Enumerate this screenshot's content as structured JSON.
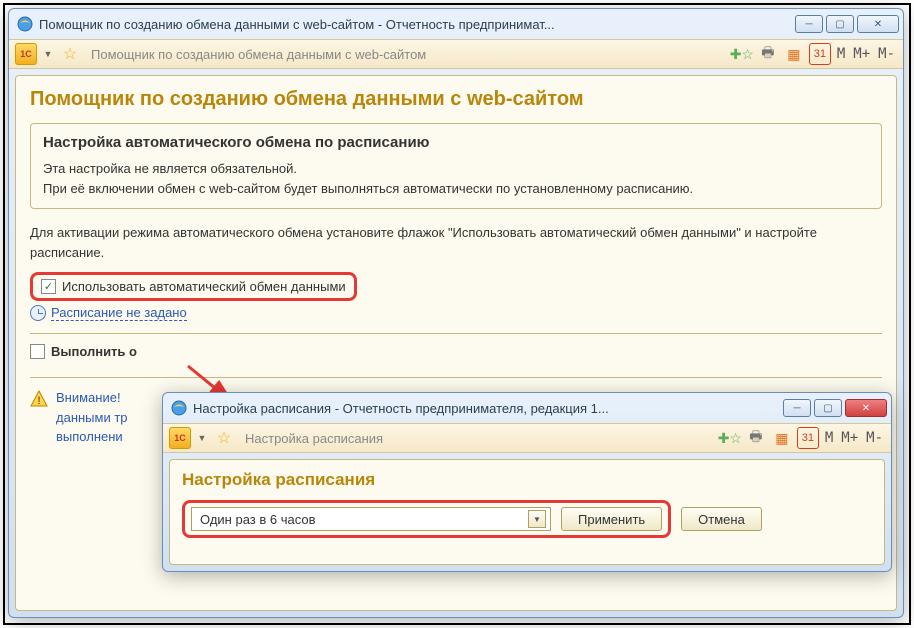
{
  "main_window": {
    "title": "Помощник по созданию обмена данными с web-сайтом - Отчетность предпринимат...",
    "breadcrumb": "Помощник по созданию обмена данными с web-сайтом",
    "toolbar_m": [
      "M",
      "M+",
      "M-"
    ]
  },
  "page": {
    "title": "Помощник по созданию обмена данными с web-сайтом",
    "section_title": "Настройка автоматического обмена по расписанию",
    "section_line1": "Эта настройка не является обязательной.",
    "section_line2": "При её включении обмен с web-сайтом будет выполняться автоматически по установленному расписанию.",
    "body_text": "Для активации режима автоматического обмена установите флажок \"Использовать автоматический обмен данными\" и настройте расписание.",
    "checkbox_label": "Использовать автоматический обмен данными",
    "checkbox_checked": true,
    "schedule_link": "Расписание не задано",
    "execute_label_prefix": "Выполнить о",
    "warning_line1": "Внимание! ",
    "warning_line2": "данными тр",
    "warning_line3": "выполнени"
  },
  "child_window": {
    "title": "Настройка расписания - Отчетность предпринимателя, редакция 1...",
    "breadcrumb": "Настройка расписания",
    "heading": "Настройка расписания",
    "combo_value": "Один раз в 6 часов",
    "apply_btn": "Применить",
    "cancel_btn": "Отмена",
    "toolbar_m": [
      "M",
      "M+",
      "M-"
    ]
  }
}
